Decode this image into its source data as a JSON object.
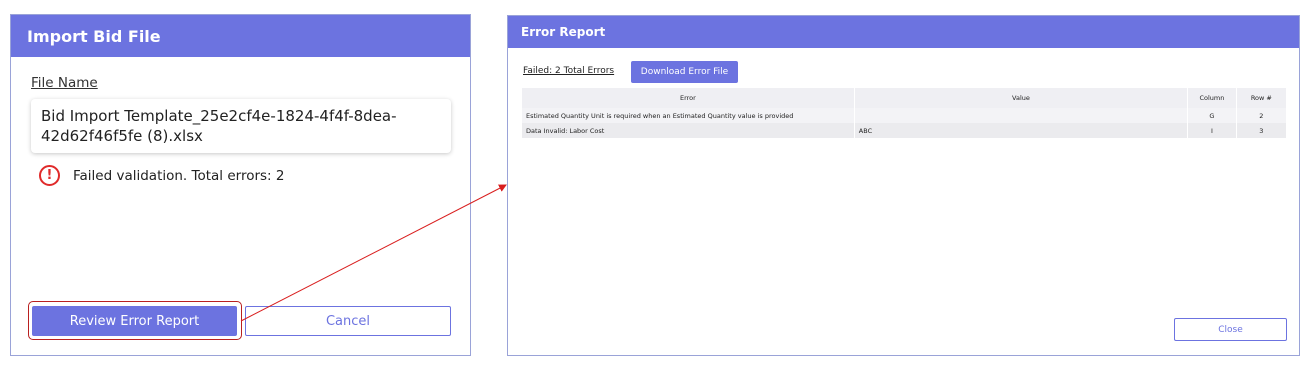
{
  "import_dialog": {
    "title": "Import Bid File",
    "file_name_label": "File Name",
    "file_name": "Bid Import Template_25e2cf4e-1824-4f4f-8dea-42d62f46f5fe (8).xlsx",
    "error_icon_glyph": "!",
    "error_message": "Failed validation. Total errors: 2",
    "review_button": "Review Error Report",
    "cancel_button": "Cancel"
  },
  "error_report": {
    "title": "Error Report",
    "failed_summary": "Failed: 2 Total Errors",
    "download_button": "Download Error File",
    "columns": [
      "Error",
      "Value",
      "Column",
      "Row #"
    ],
    "rows": [
      {
        "error": "Estimated Quantity Unit is required when an Estimated Quantity value is provided",
        "value": "",
        "column": "G",
        "row": "2"
      },
      {
        "error": "Data Invalid: Labor Cost",
        "value": "ABC",
        "column": "I",
        "row": "3"
      }
    ],
    "close_button": "Close"
  },
  "colors": {
    "accent": "#6c73e0",
    "error": "#e02a2a",
    "annotation": "#b92020"
  },
  "icons": {
    "error_icon": "exclamation-circle-icon"
  }
}
